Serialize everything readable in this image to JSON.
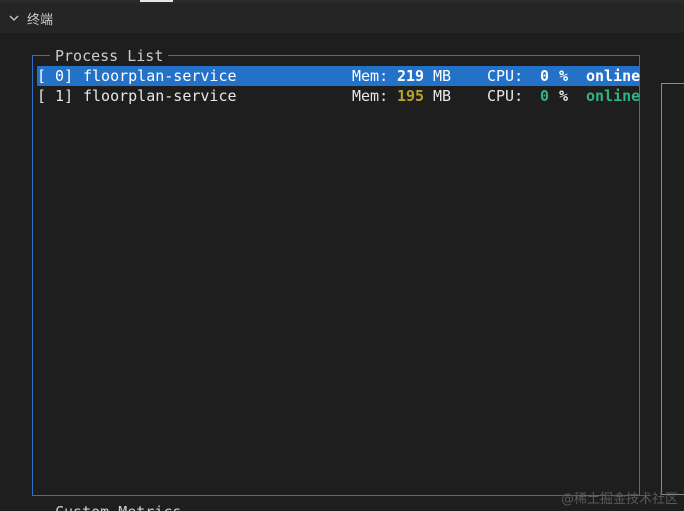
{
  "panel": {
    "title": "终端"
  },
  "process_list": {
    "title": "Process List",
    "mem_label": "Mem:",
    "mem_unit": "MB",
    "cpu_label": "CPU:",
    "rows": [
      {
        "index": "[ 0]",
        "name": "floorplan-service",
        "mem": "219",
        "cpu": "0",
        "pct": "%",
        "status": "online",
        "selected": true
      },
      {
        "index": "[ 1]",
        "name": "floorplan-service",
        "mem": "195",
        "cpu": "0",
        "pct": "%",
        "status": "online",
        "selected": false
      }
    ]
  },
  "next_box": {
    "title": "Custom Metrics"
  },
  "watermark": "@稀土掘金技术社区",
  "colors": {
    "selection": "#2472c8",
    "border": "#2e6fc7",
    "mem_value": "#b3a32e",
    "online": "#2fb380"
  },
  "icons": {
    "collapse": "chevron-down-icon"
  }
}
